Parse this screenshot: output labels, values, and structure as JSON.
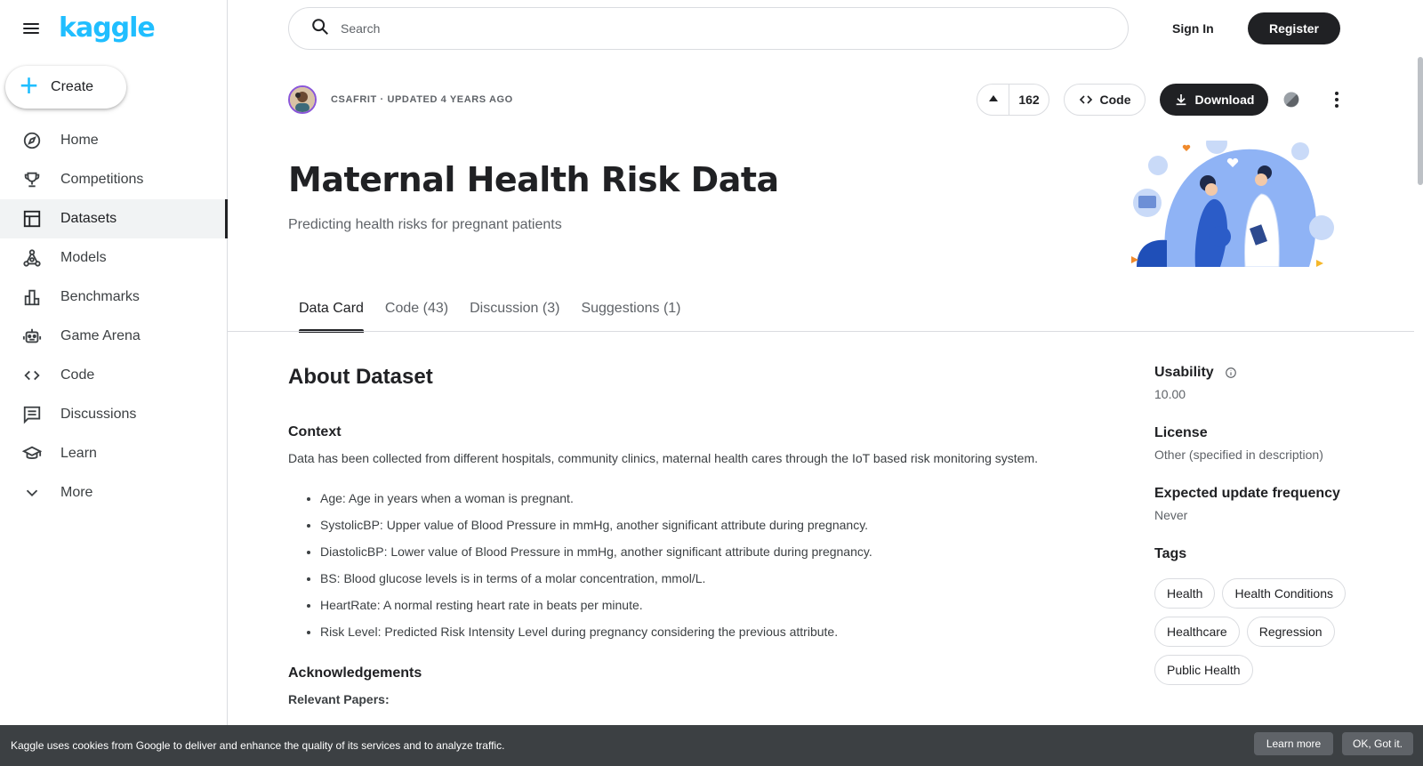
{
  "brand": {
    "logo": "kaggle",
    "accent": "#20beff"
  },
  "sidebar": {
    "create_label": "Create",
    "items": [
      {
        "label": "Home",
        "icon": "compass-icon"
      },
      {
        "label": "Competitions",
        "icon": "trophy-icon"
      },
      {
        "label": "Datasets",
        "icon": "table-icon",
        "active": true
      },
      {
        "label": "Models",
        "icon": "models-icon"
      },
      {
        "label": "Benchmarks",
        "icon": "bar-chart-icon"
      },
      {
        "label": "Game Arena",
        "icon": "robot-icon"
      },
      {
        "label": "Code",
        "icon": "code-icon"
      },
      {
        "label": "Discussions",
        "icon": "comment-icon"
      },
      {
        "label": "Learn",
        "icon": "school-icon"
      },
      {
        "label": "More",
        "icon": "chevron-down-icon"
      }
    ]
  },
  "topbar": {
    "search_placeholder": "Search",
    "signin_label": "Sign In",
    "register_label": "Register"
  },
  "dataset": {
    "owner_line": "CSAFRIT · UPDATED 4 YEARS AGO",
    "votes": "162",
    "code_label": "Code",
    "download_label": "Download",
    "title": "Maternal Health Risk Data",
    "subtitle": "Predicting health risks for pregnant patients"
  },
  "tabs": [
    {
      "label": "Data Card",
      "active": true
    },
    {
      "label": "Code (43)"
    },
    {
      "label": "Discussion (3)"
    },
    {
      "label": "Suggestions (1)"
    }
  ],
  "content": {
    "about_heading": "About Dataset",
    "context_heading": "Context",
    "context_text": "Data has been collected from different hospitals, community clinics, maternal health cares through the IoT based risk monitoring system.",
    "bullets": [
      "Age: Age in years when a woman is pregnant.",
      "SystolicBP: Upper value of Blood Pressure in mmHg, another significant attribute during pregnancy.",
      "DiastolicBP: Lower value of Blood Pressure in mmHg, another significant attribute during pregnancy.",
      "BS: Blood glucose levels is in terms of a molar concentration, mmol/L.",
      "HeartRate: A normal resting heart rate in beats per minute.",
      "Risk Level: Predicted Risk Intensity Level during pregnancy considering the previous attribute."
    ],
    "ack_heading": "Acknowledgements",
    "relevant_label": "Relevant Papers:"
  },
  "meta": {
    "usability_label": "Usability",
    "usability_value": "10.00",
    "license_label": "License",
    "license_value": "Other (specified in description)",
    "frequency_label": "Expected update frequency",
    "frequency_value": "Never",
    "tags_label": "Tags",
    "tags": [
      "Health",
      "Health Conditions",
      "Healthcare",
      "Regression",
      "Public Health"
    ]
  },
  "cookie": {
    "message": "Kaggle uses cookies from Google to deliver and enhance the quality of its services and to analyze traffic.",
    "learn_more": "Learn more",
    "ok": "OK, Got it."
  }
}
